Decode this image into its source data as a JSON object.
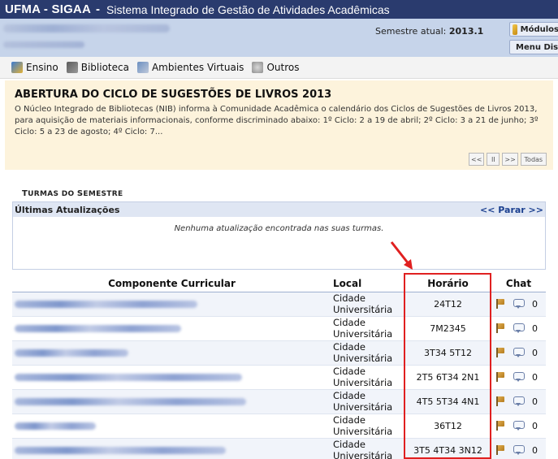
{
  "header": {
    "system": "UFMA - SIGAA",
    "separator": "-",
    "description": "Sistema Integrado de Gestão de Atividades Acadêmicas"
  },
  "info": {
    "semestre_label": "Semestre atual:",
    "semestre_value": "2013.1",
    "modulos_label": "Módulos",
    "menu_label": "Menu Discente"
  },
  "menu": [
    {
      "label": "Ensino",
      "icon": "ensino-icon"
    },
    {
      "label": "Biblioteca",
      "icon": "biblioteca-icon"
    },
    {
      "label": "Ambientes Virtuais",
      "icon": "ambientes-virtuais-icon"
    },
    {
      "label": "Outros",
      "icon": "outros-icon"
    }
  ],
  "notice": {
    "title": "ABERTURA DO CICLO DE SUGESTÕES DE LIVROS 2013",
    "body": "O Núcleo Integrado de Bibliotecas (NIB) informa à Comunidade Acadêmica o calendário dos Ciclos de Sugestões de Livros 2013, para aquisição de materiais informacionais, conforme discriminado abaixo: 1º Ciclo: 2 a 19 de abril; 2º Ciclo: 3 a 21 de junho; 3º Ciclo: 5 a 23 de agosto; 4º Ciclo: 7...",
    "controls": {
      "prev": "<<",
      "pause": "II",
      "next": ">>",
      "all": "Todas"
    }
  },
  "turmas_section": {
    "title_first": "T",
    "title_rest": "URMAS DO ",
    "title_first2": "S",
    "title_rest2": "EMESTRE"
  },
  "updates": {
    "title": "Últimas Atualizações",
    "stop_label": "<< Parar >>",
    "empty_message": "Nenhuma atualização encontrada nas suas turmas."
  },
  "table": {
    "headers": {
      "componente": "Componente Curricular",
      "local": "Local",
      "horario": "Horário",
      "chat": "Chat"
    },
    "rows": [
      {
        "local_1": "Cidade",
        "local_2": "Universitária",
        "horario": "24T12",
        "chat_count": "0"
      },
      {
        "local_1": "Cidade",
        "local_2": "Universitária",
        "horario": "7M2345",
        "chat_count": "0"
      },
      {
        "local_1": "Cidade",
        "local_2": "Universitária",
        "horario": "3T34 5T12",
        "chat_count": "0"
      },
      {
        "local_1": "Cidade",
        "local_2": "Universitária",
        "horario": "2T5 6T34 2N1",
        "chat_count": "0"
      },
      {
        "local_1": "Cidade",
        "local_2": "Universitária",
        "horario": "4T5 5T34 4N1",
        "chat_count": "0"
      },
      {
        "local_1": "Cidade",
        "local_2": "Universitária",
        "horario": "36T12",
        "chat_count": "0"
      },
      {
        "local_1": "Cidade",
        "local_2": "Universitária",
        "horario": "3T5 4T34 3N12",
        "chat_count": "0"
      }
    ]
  },
  "colors": {
    "header_bg": "#2a3b6e",
    "info_bg": "#c6d4ea",
    "notice_bg": "#fdf3dc",
    "highlight": "#e02020",
    "link": "#1a3f8f"
  }
}
